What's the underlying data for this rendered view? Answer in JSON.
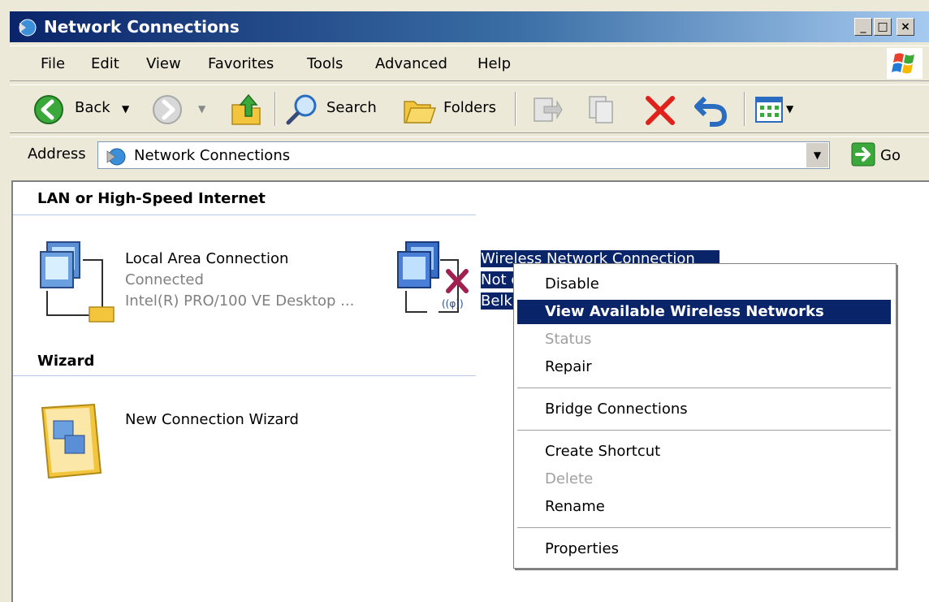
{
  "window": {
    "title": "Network Connections",
    "controls": {
      "minimize": "_",
      "maximize": "□",
      "close": "×"
    }
  },
  "menubar": [
    "File",
    "Edit",
    "View",
    "Favorites",
    "Tools",
    "Advanced",
    "Help"
  ],
  "toolbar": {
    "back_label": "Back",
    "search_label": "Search",
    "folders_label": "Folders"
  },
  "address": {
    "label": "Address",
    "value": "Network Connections",
    "go_label": "Go"
  },
  "groups": {
    "lan_header": "LAN or High-Speed Internet",
    "wizard_header": "Wizard"
  },
  "items": {
    "lan": {
      "name": "Local Area Connection",
      "status": "Connected",
      "device": "Intel(R) PRO/100 VE Desktop ..."
    },
    "wireless": {
      "name": "Wireless Network Connection",
      "status_partial": "Not c",
      "device_partial": "Belki"
    },
    "wizard": {
      "name": "New Connection Wizard"
    }
  },
  "context_menu": {
    "items": [
      {
        "label": "Disable",
        "state": "normal"
      },
      {
        "label": "View Available Wireless Networks",
        "state": "highlighted"
      },
      {
        "label": "Status",
        "state": "disabled"
      },
      {
        "label": "Repair",
        "state": "normal"
      },
      {
        "label": "Bridge Connections",
        "state": "normal"
      },
      {
        "label": "Create Shortcut",
        "state": "normal"
      },
      {
        "label": "Delete",
        "state": "disabled"
      },
      {
        "label": "Rename",
        "state": "normal"
      },
      {
        "label": "Properties",
        "state": "normal"
      }
    ]
  },
  "colors": {
    "selection": "#0a246a",
    "titlebar_start": "#0a246a",
    "chrome": "#ece9d8",
    "delete_red": "#e0201a"
  },
  "icons": [
    "network-connections-icon",
    "windows-logo-icon",
    "back-icon",
    "forward-icon",
    "up-folder-icon",
    "search-icon",
    "folders-icon",
    "move-to-icon",
    "copy-to-icon",
    "delete-icon",
    "undo-icon",
    "views-icon",
    "go-icon",
    "lan-connection-icon",
    "wireless-connection-icon",
    "wizard-icon"
  ]
}
